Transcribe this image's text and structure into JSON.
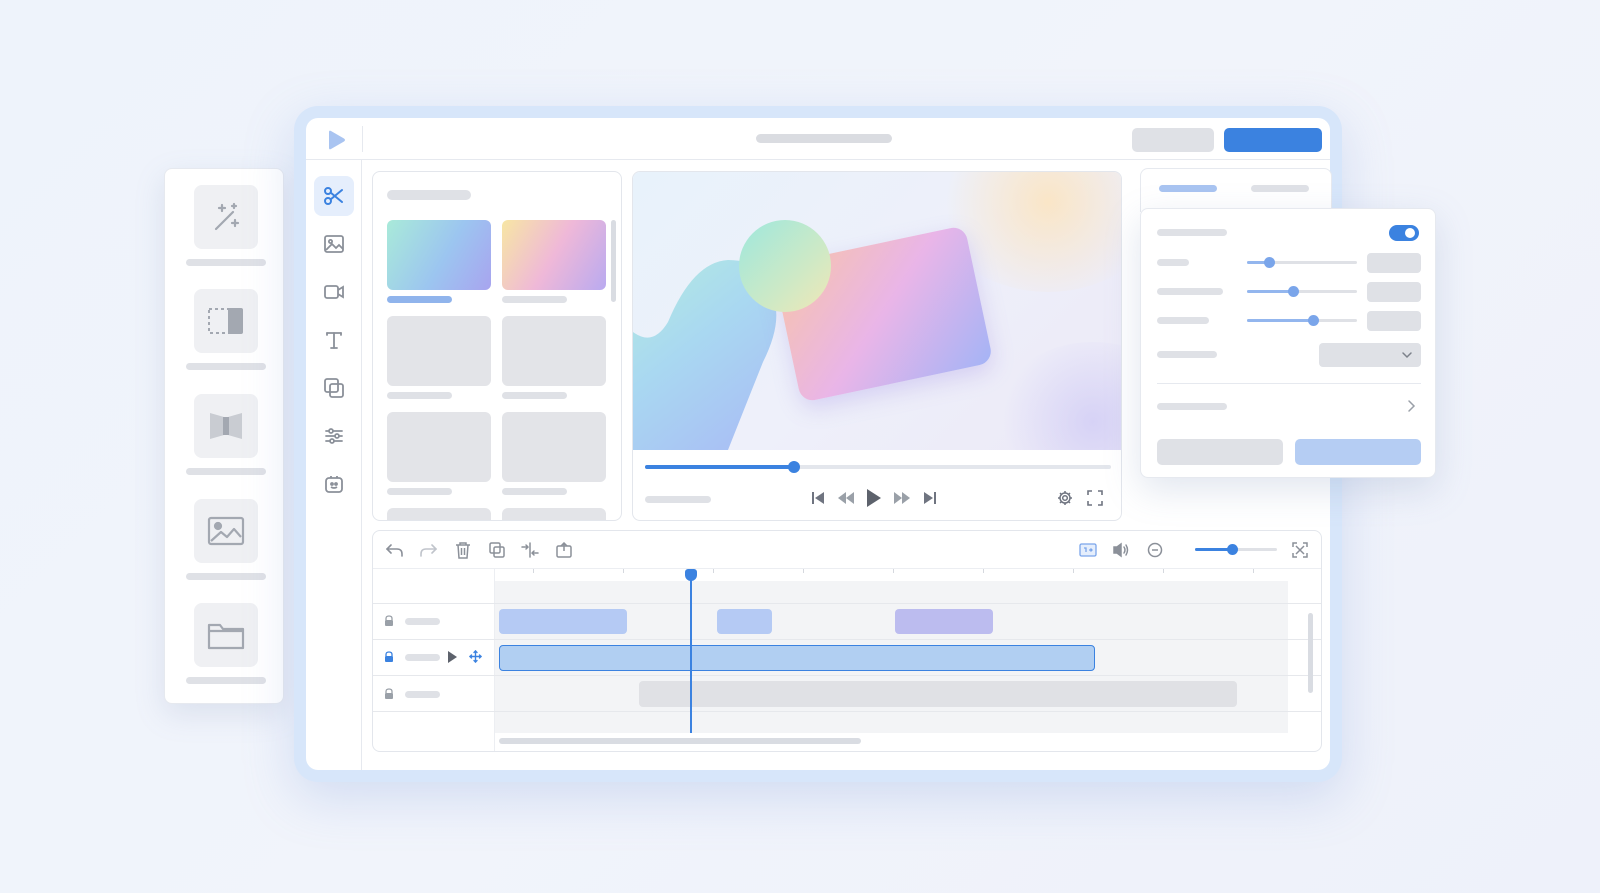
{
  "app": {
    "title": "",
    "accent": "#3b82e0"
  },
  "left_tools": [
    {
      "name": "magic-tool",
      "icon": "magic-wand-icon"
    },
    {
      "name": "crop-tool",
      "icon": "crop-icon"
    },
    {
      "name": "transition-tool",
      "icon": "transition-icon"
    },
    {
      "name": "image-tool",
      "icon": "image-icon"
    },
    {
      "name": "folder-tool",
      "icon": "folder-icon"
    }
  ],
  "toolrail": [
    {
      "icon": "scissors-icon",
      "active": true
    },
    {
      "icon": "image-icon"
    },
    {
      "icon": "video-icon"
    },
    {
      "icon": "text-icon"
    },
    {
      "icon": "layers-icon"
    },
    {
      "icon": "adjust-icon"
    },
    {
      "icon": "sticker-icon"
    }
  ],
  "preview": {
    "progress": 0.32
  },
  "timeline": {
    "zoom": 0.45,
    "tracks": 3
  },
  "properties": {
    "toggle_on": true,
    "sliders": [
      0.2,
      0.42,
      0.6
    ]
  },
  "colors": {
    "primary": "#3b82e0",
    "clip_blue": "#b5caf4",
    "clip_purple": "#bcbcef",
    "clip_selected": "#b1cff2",
    "placeholder": "#dfe1e6"
  }
}
